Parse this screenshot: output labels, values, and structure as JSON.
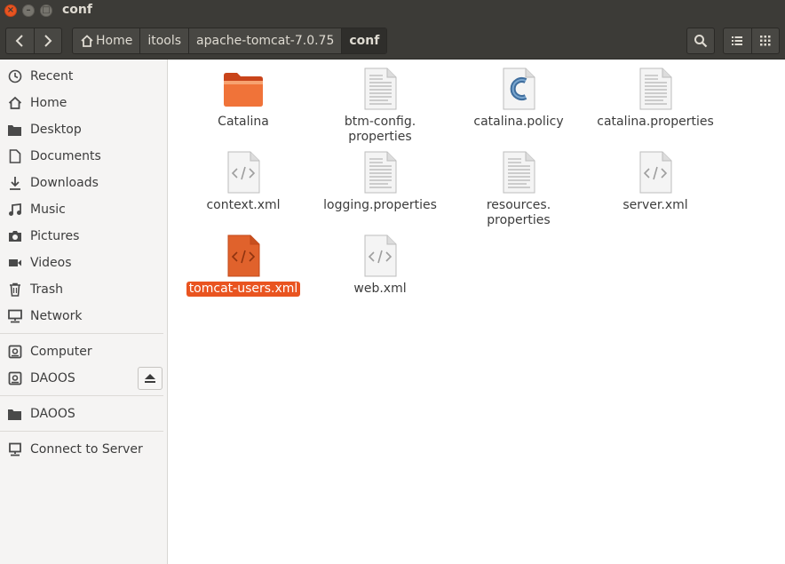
{
  "window": {
    "title": "conf"
  },
  "breadcrumbs": [
    {
      "label": "Home"
    },
    {
      "label": "itools"
    },
    {
      "label": "apache-tomcat-7.0.75"
    },
    {
      "label": "conf"
    }
  ],
  "toolbar": {
    "back_icon": "chevron-left-icon",
    "forward_icon": "chevron-right-icon",
    "search_icon": "search-icon",
    "list_view_icon": "list-view-icon",
    "grid_view_icon": "grid-view-icon"
  },
  "sidebar": {
    "items": [
      {
        "label": "Recent",
        "icon": "clock-icon"
      },
      {
        "label": "Home",
        "icon": "home-icon"
      },
      {
        "label": "Desktop",
        "icon": "folder-icon"
      },
      {
        "label": "Documents",
        "icon": "document-icon"
      },
      {
        "label": "Downloads",
        "icon": "download-icon"
      },
      {
        "label": "Music",
        "icon": "music-icon"
      },
      {
        "label": "Pictures",
        "icon": "camera-icon"
      },
      {
        "label": "Videos",
        "icon": "video-icon"
      },
      {
        "label": "Trash",
        "icon": "trash-icon"
      },
      {
        "label": "Network",
        "icon": "network-icon"
      },
      {
        "label": "Computer",
        "icon": "drive-icon"
      },
      {
        "label": "DAOOS",
        "icon": "drive-icon"
      },
      {
        "label": "DAOOS",
        "icon": "folder-icon"
      },
      {
        "label": "Connect to Server",
        "icon": "server-icon"
      }
    ]
  },
  "files": [
    {
      "name": "Catalina",
      "type": "folder"
    },
    {
      "name": "btm-config.\nproperties",
      "type": "text"
    },
    {
      "name": "catalina.policy",
      "type": "c-source"
    },
    {
      "name": "catalina.properties",
      "type": "text"
    },
    {
      "name": "context.xml",
      "type": "xml"
    },
    {
      "name": "logging.properties",
      "type": "text"
    },
    {
      "name": "resources.\nproperties",
      "type": "text"
    },
    {
      "name": "server.xml",
      "type": "xml"
    },
    {
      "name": "tomcat-users.xml",
      "type": "xml",
      "selected": true
    },
    {
      "name": "web.xml",
      "type": "xml"
    }
  ],
  "colors": {
    "accent": "#e95420",
    "titlebar": "#3c3b37",
    "sidebar": "#f5f4f3"
  }
}
